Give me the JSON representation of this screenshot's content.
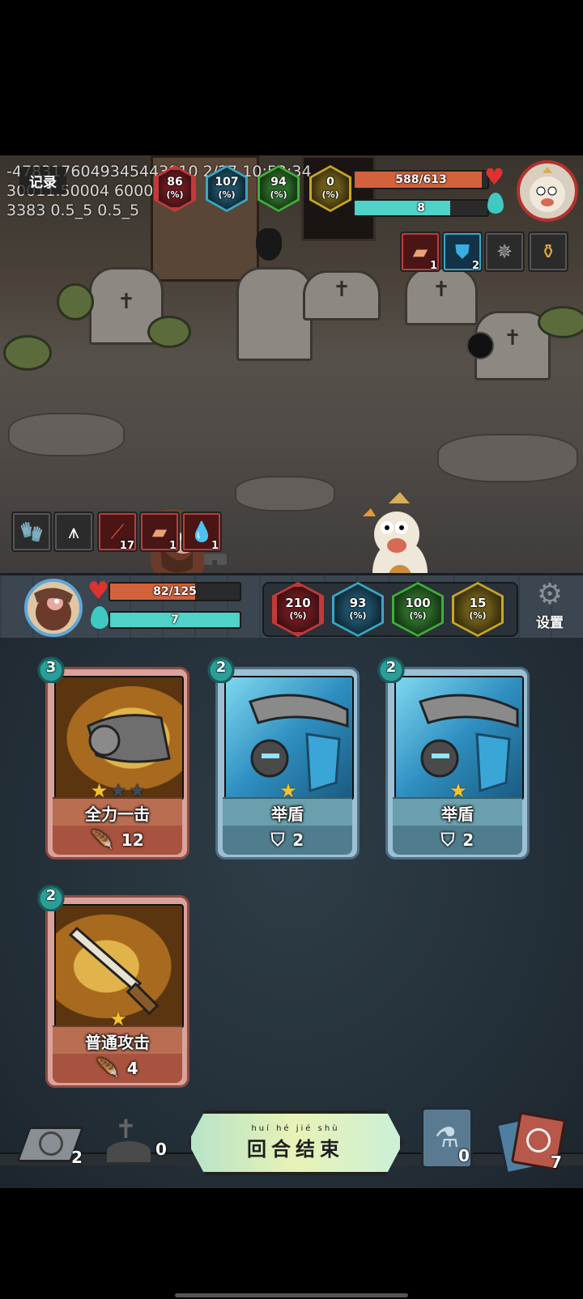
{
  "debug": {
    "line1": "-4783176049345443910 2/27 10:52:34",
    "line2": "30011.50004 6000",
    "line3": "3383 0.5_5 0.5_5"
  },
  "record_button_label": "记录",
  "enemy": {
    "hp_text": "588/613",
    "hp_fraction": 0.959,
    "energy_text": "8",
    "energy_fraction": 0.72,
    "stats": [
      {
        "value": "86",
        "unit": "(%)",
        "icon": "attack-down-icon",
        "color": "#c23a3a"
      },
      {
        "value": "107",
        "unit": "(%)",
        "icon": "mystery-icon",
        "color": "#36a8c8"
      },
      {
        "value": "94",
        "unit": "(%)",
        "icon": "defense-icon",
        "color": "#3fae3a"
      },
      {
        "value": "0",
        "unit": "(%)",
        "icon": "crit-icon",
        "color": "#c8a526"
      }
    ],
    "statuses": [
      {
        "icon": "bandage-icon",
        "count": "1"
      },
      {
        "icon": "shield-icon",
        "count": "2"
      },
      {
        "icon": "spiked-trap-icon",
        "count": ""
      },
      {
        "icon": "golden-brush-icon",
        "count": ""
      }
    ]
  },
  "player": {
    "hp_text": "82/125",
    "hp_fraction": 0.656,
    "energy_text": "7",
    "energy_fraction": 1.0,
    "stats": [
      {
        "value": "210",
        "unit": "(%)",
        "icon": "attack-down-icon",
        "color": "#c23a3a"
      },
      {
        "value": "93",
        "unit": "(%)",
        "icon": "mystery-icon",
        "color": "#36a8c8"
      },
      {
        "value": "100",
        "unit": "(%)",
        "icon": "defense-icon",
        "color": "#3fae3a"
      },
      {
        "value": "15",
        "unit": "(%)",
        "icon": "crit-icon",
        "color": "#c8a526"
      }
    ],
    "statuses": [
      {
        "icon": "gauntlet-icon",
        "count": ""
      },
      {
        "icon": "spike-trap-icon",
        "count": ""
      },
      {
        "icon": "claw-slash-icon",
        "count": "17"
      },
      {
        "icon": "bandage-icon",
        "count": "1"
      },
      {
        "icon": "blood-drops-icon",
        "count": "1"
      }
    ]
  },
  "settings_label": "设置",
  "cards": [
    {
      "cost": "3",
      "name": "全力一击",
      "value": "12",
      "value_icon": "attack-icon",
      "stars_on": 1,
      "stars_total": 3,
      "style": "red"
    },
    {
      "cost": "2",
      "name": "举盾",
      "value": "2",
      "value_icon": "shield-icon",
      "stars_on": 1,
      "stars_total": 1,
      "style": "blue"
    },
    {
      "cost": "2",
      "name": "举盾",
      "value": "2",
      "value_icon": "shield-icon",
      "stars_on": 1,
      "stars_total": 1,
      "style": "blue"
    },
    {
      "cost": "2",
      "name": "普通攻击",
      "value": "4",
      "value_icon": "attack-icon",
      "stars_on": 1,
      "stars_total": 1,
      "style": "red"
    }
  ],
  "bottom": {
    "draw_pile_count": "2",
    "grave_count": "0",
    "end_turn_label": "回合结束",
    "end_turn_pinyin": "huí hé jié shù",
    "potion_count": "0",
    "deck_count": "7"
  },
  "colors": {
    "hp": "#d2623c",
    "energy": "#4fd2c8",
    "accent_teal": "#2b9e9a"
  }
}
